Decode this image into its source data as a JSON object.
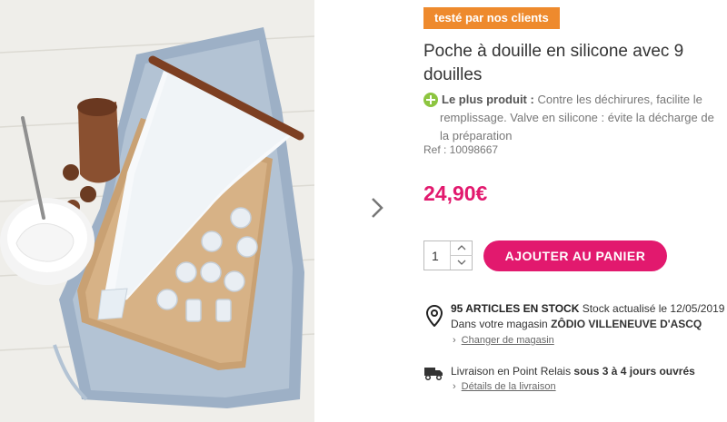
{
  "product": {
    "badge": "testé par nos clients",
    "title": "Poche à douille en silicone avec 9 douilles",
    "plus_label": "Le plus produit :",
    "plus_text": "Contre les déchirures, facilite le remplissage. Valve en silicone : évite la décharge de la préparation",
    "ref": "Ref : 10098667",
    "price": "24,90€"
  },
  "cart": {
    "quantity": "1",
    "add_button": "AJOUTER AU PANIER"
  },
  "stock": {
    "count_label": "95 ARTICLES EN STOCK",
    "updated": "Stock actualisé le 12/05/2019",
    "store_prefix": "Dans votre magasin",
    "store_name": "ZÔDIO VILLENEUVE D'ASCQ",
    "change_store": "Changer de magasin"
  },
  "delivery": {
    "prefix": "Livraison en Point Relais",
    "delay": "sous 3 à 4 jours ouvrés",
    "details": "Détails de la livraison"
  },
  "colors": {
    "accent": "#e2196e",
    "badge": "#ee8a2d",
    "plus_icon": "#8dc540"
  },
  "icons": {
    "next": "chevron-right-icon",
    "plus": "plus-circle-icon",
    "location": "map-pin-icon",
    "delivery": "truck-icon"
  }
}
